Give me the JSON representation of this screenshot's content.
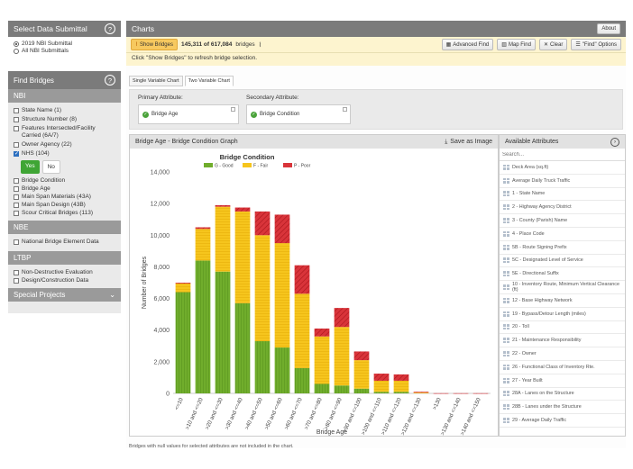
{
  "left": {
    "title": "Select Data Submittal",
    "submittals": [
      {
        "label": "2019 NBI Submittal",
        "selected": true
      },
      {
        "label": "All NBI Submittals",
        "selected": false
      }
    ],
    "find_title": "Find Bridges",
    "nbi_title": "NBI",
    "nbi_items": [
      {
        "label": "State Name (1)",
        "checked": false
      },
      {
        "label": "Structure Number (8)",
        "checked": false
      },
      {
        "label": "Features Intersected/Facility Carried (6A/7)",
        "checked": false
      },
      {
        "label": "Owner Agency (22)",
        "checked": false
      },
      {
        "label": "NHS (104)",
        "checked": true
      }
    ],
    "yes_label": "Yes",
    "no_label": "No",
    "nbi_items2": [
      {
        "label": "Bridge Condition",
        "checked": false
      },
      {
        "label": "Bridge Age",
        "checked": false
      },
      {
        "label": "Main Span Materials (43A)",
        "checked": false
      },
      {
        "label": "Main Span Design (43B)",
        "checked": false
      },
      {
        "label": "Scour Critical Bridges (113)",
        "checked": false
      }
    ],
    "nbe_title": "NBE",
    "nbe_items": [
      {
        "label": "National Bridge Element Data",
        "checked": false
      }
    ],
    "ltbp_title": "LTBP",
    "ltbp_items": [
      {
        "label": "Non-Destructive Evaluation",
        "checked": false
      },
      {
        "label": "Design/Construction Data",
        "checked": false
      }
    ],
    "special_title": "Special Projects"
  },
  "right": {
    "title": "Charts",
    "about": "About",
    "show_bridges": "Show Bridges",
    "count_text": "145,311 of 617,084",
    "count_suffix": "bridges",
    "advanced_find": "Advanced Find",
    "map_find": "Map Find",
    "clear": "Clear",
    "find_options": "\"Find\" Options",
    "refresh_note": "Click \"Show Bridges\" to refresh bridge selection.",
    "tabs": [
      "Single Variable Chart",
      "Two Variable Chart"
    ],
    "primary_label": "Primary Attribute:",
    "secondary_label": "Secondary Attribute:",
    "primary_value": "Bridge Age",
    "secondary_value": "Bridge Condition",
    "graph_title": "Bridge Age - Bridge Condition Graph",
    "save_image": "Save as Image",
    "available_title": "Available Attributes",
    "search_placeholder": "Search...",
    "attributes": [
      "Deck Area (sq.ft)",
      "Average Daily Truck Traffic",
      "1 - State Name",
      "2 - Highway Agency District",
      "3 - County (Parish) Name",
      "4 - Place Code",
      "5B - Route Signing Prefix",
      "5C - Designated Level of Service",
      "5E - Directional Suffix",
      "10 - Inventory Route, Minimum Vertical Clearance (ft)",
      "12 - Base Highway Network",
      "19 - Bypass/Detour Length (miles)",
      "20 - Toll",
      "21 - Maintenance Responsibility",
      "22 - Owner",
      "26 - Functional Class of Inventory Rte.",
      "27 - Year Built",
      "28A - Lanes on the Structure",
      "28B - Lanes under the Structure",
      "29 - Average Daily Traffic"
    ],
    "footer_note": "Bridges with null values for selected attributes are not included in the chart."
  },
  "colors": {
    "good": "#70ad2c",
    "fair": "#f6c51d",
    "poor": "#d9343a",
    "panel_head": "#7b7b7b",
    "yes": "#3fa535"
  },
  "chart_data": {
    "type": "bar",
    "stacked": true,
    "title": "Bridge Condition",
    "xlabel": "Bridge Age",
    "ylabel": "Number of Bridges",
    "ylim": [
      0,
      14000
    ],
    "yticks": [
      0,
      2000,
      4000,
      6000,
      8000,
      10000,
      12000,
      14000
    ],
    "ytick_labels": [
      "0",
      "2,000",
      "4,000",
      "6,000",
      "8,000",
      "10,000",
      "12,000",
      "14,000"
    ],
    "categories": [
      "<=10",
      ">10 and <=20",
      ">20 and <=30",
      ">30 and <=40",
      ">40 and <=50",
      ">50 and <=60",
      ">60 and <=70",
      ">70 and <=80",
      ">80 and <=90",
      ">90 and <=100",
      ">100 and <=110",
      ">110 and <=120",
      ">120 and <=130",
      ">130",
      ">130 and <=140",
      ">140 and <=150"
    ],
    "series": [
      {
        "name": "G - Good",
        "color": "#70ad2c",
        "values": [
          6400,
          8400,
          7700,
          5700,
          3300,
          2900,
          1600,
          600,
          500,
          300,
          100,
          100,
          0,
          0,
          0,
          0
        ]
      },
      {
        "name": "F - Fair",
        "color": "#f6c51d",
        "values": [
          550,
          2000,
          4100,
          5800,
          6700,
          6600,
          4700,
          3000,
          3700,
          1800,
          700,
          700,
          50,
          0,
          0,
          0
        ]
      },
      {
        "name": "P - Poor",
        "color": "#d9343a",
        "values": [
          50,
          100,
          100,
          250,
          1500,
          1800,
          1800,
          500,
          1200,
          550,
          450,
          400,
          50,
          10,
          10,
          10
        ]
      }
    ],
    "legend": "top-center",
    "grid": false
  }
}
